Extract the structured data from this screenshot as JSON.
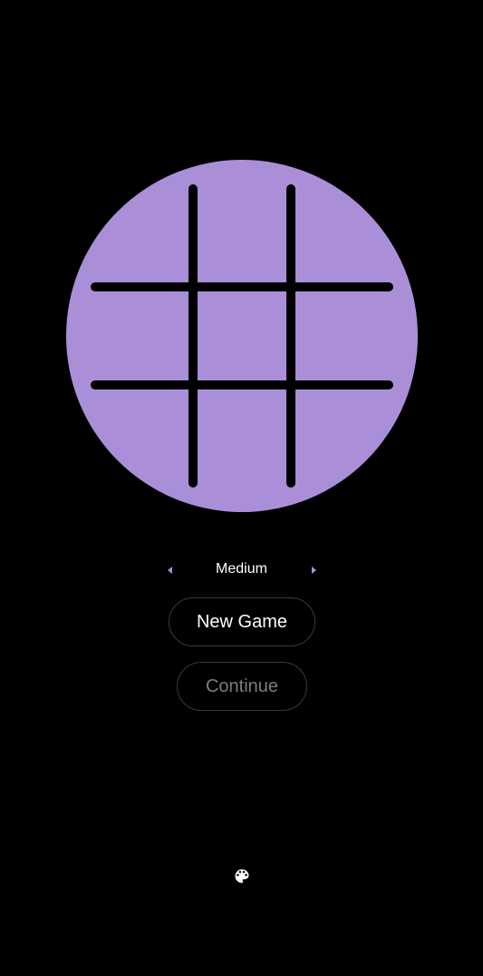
{
  "board": {
    "color": "#aa8fd8",
    "line_color": "#000000",
    "cells": [
      "",
      "",
      "",
      "",
      "",
      "",
      "",
      "",
      ""
    ]
  },
  "difficulty": {
    "label": "Medium",
    "prev_icon": "chevron-left-icon",
    "next_icon": "chevron-right-icon",
    "arrow_color": "#aa8fd8"
  },
  "buttons": {
    "new_game": "New Game",
    "continue": "Continue"
  },
  "footer": {
    "theme_icon": "palette-icon"
  }
}
